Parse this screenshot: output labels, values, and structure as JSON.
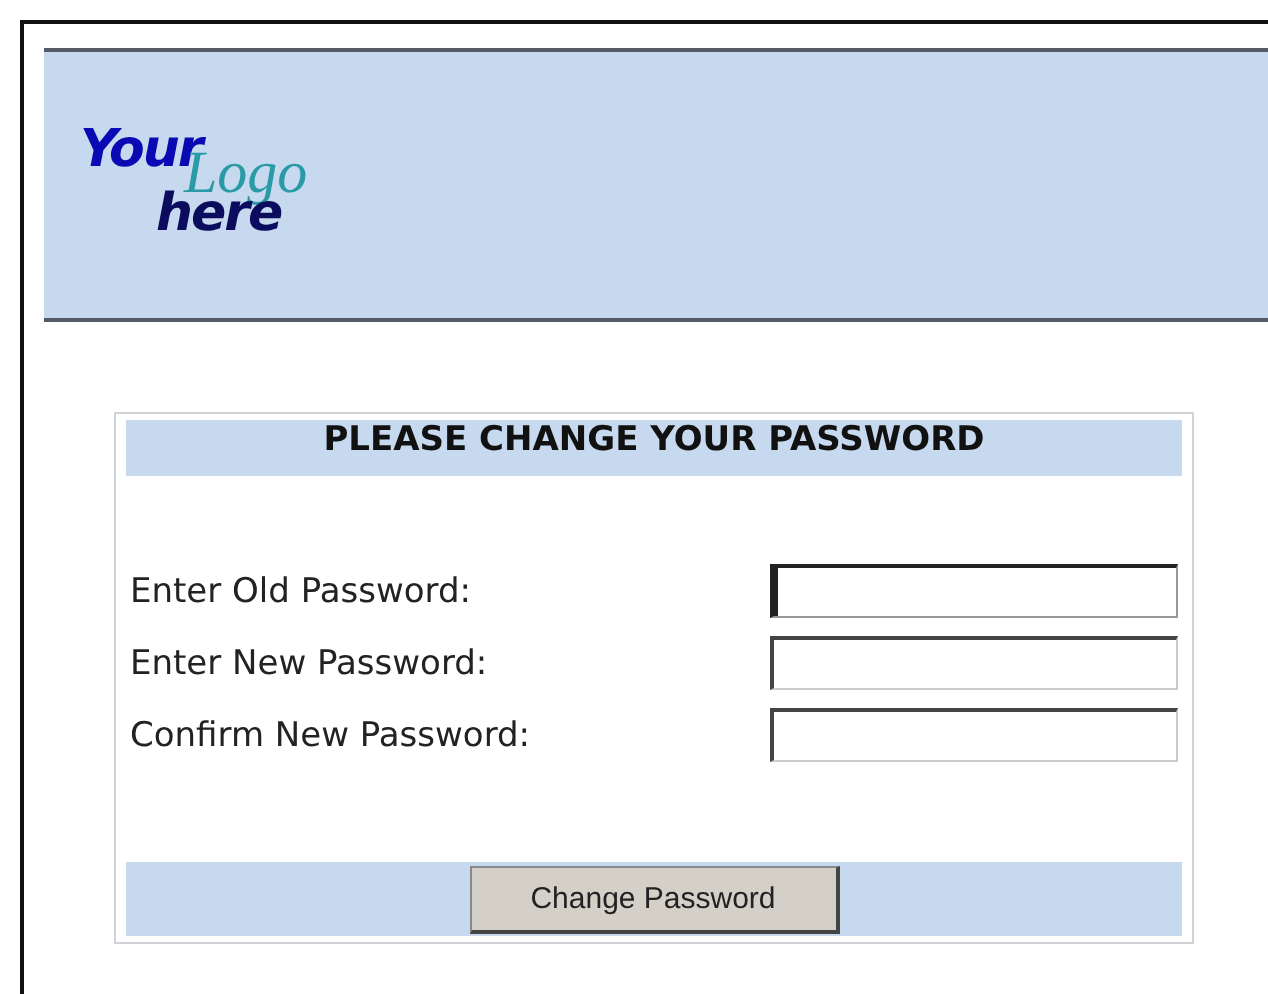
{
  "logo": {
    "top": "Your",
    "script": "Logo",
    "bottom": "here"
  },
  "form": {
    "title": "PLEASE CHANGE YOUR PASSWORD",
    "fields": [
      {
        "label": "Enter Old Password:",
        "focused": true
      },
      {
        "label": "Enter New Password:",
        "focused": false
      },
      {
        "label": "Confirm New Password:",
        "focused": false
      }
    ],
    "button": "Change Password"
  }
}
